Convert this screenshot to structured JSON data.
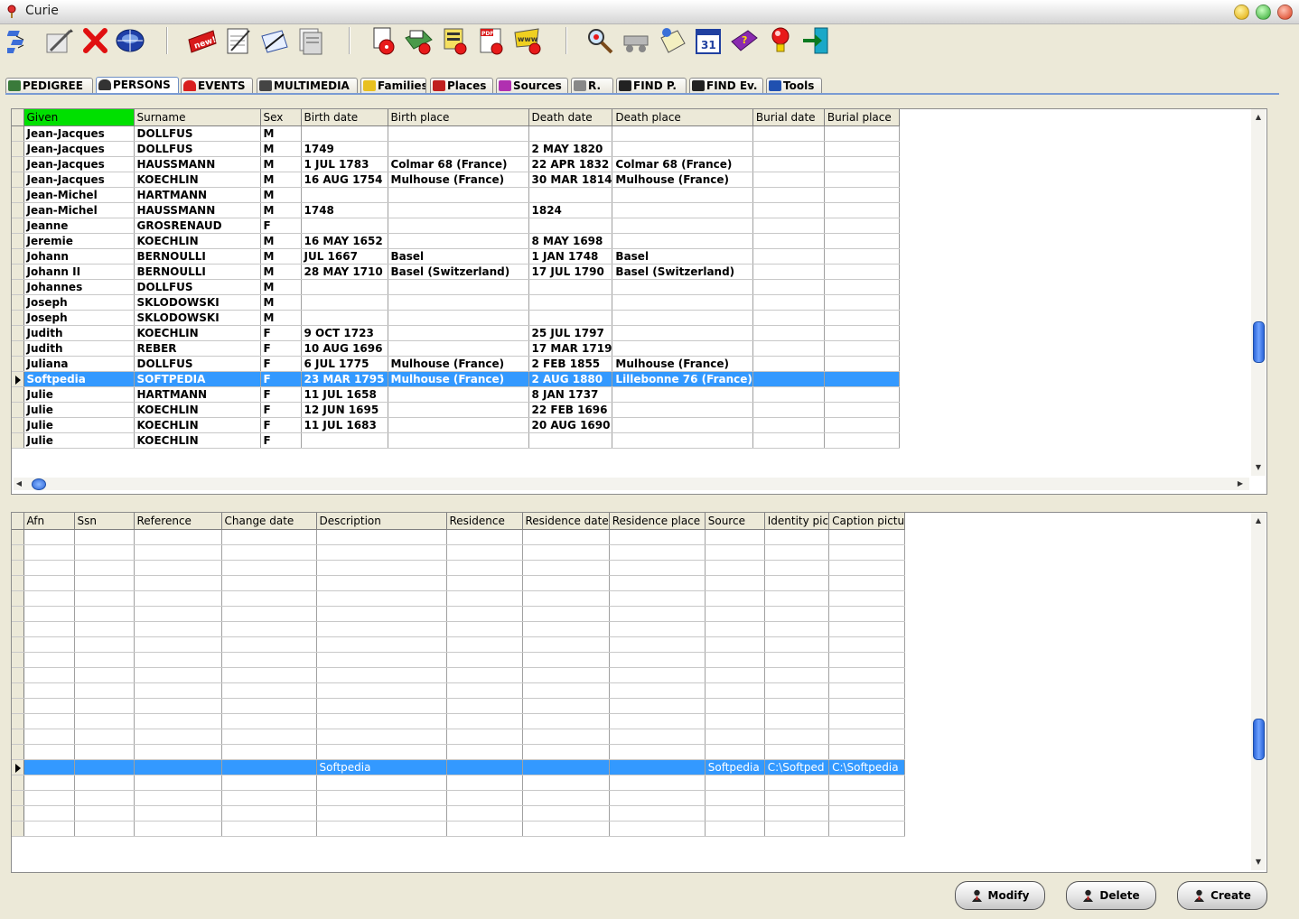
{
  "window": {
    "title": "Curie",
    "accent": "#3399ff",
    "header_highlight": "#00e000"
  },
  "toolbar": {
    "buttons": [
      {
        "name": "pedigree-tree-button",
        "icon": "tree-icon"
      },
      {
        "name": "edit-button",
        "icon": "pencil-icon"
      },
      {
        "name": "delete-button",
        "icon": "red-x-icon"
      },
      {
        "name": "compass-button",
        "icon": "compass-icon"
      },
      {
        "name": "new-button",
        "icon": "new-badge-icon"
      },
      {
        "name": "gedcom-export-button",
        "icon": "gedcom-icon"
      },
      {
        "name": "write-button",
        "icon": "quill-icon"
      },
      {
        "name": "report-button",
        "icon": "document-icon"
      },
      {
        "name": "gedcom-import-button",
        "icon": "gedcom-cd-icon"
      },
      {
        "name": "print-button",
        "icon": "printer-icon"
      },
      {
        "name": "report-cd-button",
        "icon": "report-cd-icon"
      },
      {
        "name": "pdf-button",
        "icon": "pdf-icon"
      },
      {
        "name": "web-button",
        "icon": "www-icon"
      },
      {
        "name": "search-button",
        "icon": "magnifier-icon"
      },
      {
        "name": "relationship-button",
        "icon": "cart-icon"
      },
      {
        "name": "notes-button",
        "icon": "scroll-icon"
      },
      {
        "name": "calendar-button",
        "icon": "calendar-icon"
      },
      {
        "name": "help-book-button",
        "icon": "book-icon"
      },
      {
        "name": "tips-button",
        "icon": "lightbulb-icon"
      },
      {
        "name": "exit-button",
        "icon": "exit-door-icon"
      }
    ]
  },
  "tabs": [
    {
      "label": "PEDIGREE",
      "icon": "pedigree-icon"
    },
    {
      "label": "PERSONS",
      "icon": "person-icon",
      "active": true
    },
    {
      "label": "EVENTS",
      "icon": "bell-icon"
    },
    {
      "label": "MULTIMEDIA",
      "icon": "camera-icon"
    },
    {
      "label": "Families",
      "icon": "family-icon"
    },
    {
      "label": "Places",
      "icon": "places-icon"
    },
    {
      "label": "Sources",
      "icon": "books-icon"
    },
    {
      "label": "R.",
      "icon": "edit-icon"
    },
    {
      "label": "FIND P.",
      "icon": "binoculars-icon"
    },
    {
      "label": "FIND Ev.",
      "icon": "binoculars-icon"
    },
    {
      "label": "Tools",
      "icon": "tools-icon"
    }
  ],
  "persons_grid": {
    "columns": [
      "Given",
      "Surname",
      "Sex",
      "Birth date",
      "Birth place",
      "Death date",
      "Death place",
      "Burial date",
      "Burial place"
    ],
    "rows": [
      [
        "Jean-Jacques",
        "DOLLFUS",
        "M",
        "",
        "",
        "",
        "",
        "",
        ""
      ],
      [
        "Jean-Jacques",
        "DOLLFUS",
        "M",
        "1749",
        "",
        "2 MAY 1820",
        "",
        "",
        ""
      ],
      [
        "Jean-Jacques",
        "HAUSSMANN",
        "M",
        "1 JUL 1783",
        "Colmar  68  (France)",
        "22 APR 1832",
        "Colmar  68  (France)",
        "",
        ""
      ],
      [
        "Jean-Jacques",
        "KOECHLIN",
        "M",
        "16 AUG 1754",
        "Mulhouse (France)",
        "30 MAR 1814",
        "Mulhouse (France)",
        "",
        ""
      ],
      [
        "Jean-Michel",
        "HARTMANN",
        "M",
        "",
        "",
        "",
        "",
        "",
        ""
      ],
      [
        "Jean-Michel",
        "HAUSSMANN",
        "M",
        "1748",
        "",
        "1824",
        "",
        "",
        ""
      ],
      [
        "Jeanne",
        "GROSRENAUD",
        "F",
        "",
        "",
        "",
        "",
        "",
        ""
      ],
      [
        "Jeremie",
        "KOECHLIN",
        "M",
        "16 MAY 1652",
        "",
        "8 MAY 1698",
        "",
        "",
        ""
      ],
      [
        "Johann",
        "BERNOULLI",
        "M",
        "JUL 1667",
        "Basel",
        "1 JAN 1748",
        "Basel",
        "",
        ""
      ],
      [
        "Johann II",
        "BERNOULLI",
        "M",
        "28 MAY 1710",
        "Basel (Switzerland)",
        "17 JUL 1790",
        "Basel (Switzerland)",
        "",
        ""
      ],
      [
        "Johannes",
        "DOLLFUS",
        "M",
        "",
        "",
        "",
        "",
        "",
        ""
      ],
      [
        "Joseph",
        "SKLODOWSKI",
        "M",
        "",
        "",
        "",
        "",
        "",
        ""
      ],
      [
        "Joseph",
        "SKLODOWSKI",
        "M",
        "",
        "",
        "",
        "",
        "",
        ""
      ],
      [
        "Judith",
        "KOECHLIN",
        "F",
        "9 OCT 1723",
        "",
        "25 JUL 1797",
        "",
        "",
        ""
      ],
      [
        "Judith",
        "REBER",
        "F",
        "10 AUG 1696",
        "",
        "17 MAR 1719",
        "",
        "",
        ""
      ],
      [
        "Juliana",
        "DOLLFUS",
        "F",
        "6 JUL 1775",
        "Mulhouse (France)",
        "2 FEB 1855",
        "Mulhouse (France)",
        "",
        ""
      ],
      [
        "Softpedia",
        "SOFTPEDIA",
        "F",
        "23 MAR 1795",
        "Mulhouse (France)",
        "2 AUG 1880",
        "Lillebonne 76 (France)",
        "",
        ""
      ],
      [
        "Julie",
        "HARTMANN",
        "F",
        "11 JUL 1658",
        "",
        "8 JAN 1737",
        "",
        "",
        ""
      ],
      [
        "Julie",
        "KOECHLIN",
        "F",
        "12 JUN 1695",
        "",
        "22 FEB 1696",
        "",
        "",
        ""
      ],
      [
        "Julie",
        "KOECHLIN",
        "F",
        "11 JUL 1683",
        "",
        "20 AUG 1690",
        "",
        "",
        ""
      ],
      [
        "Julie",
        "KOECHLIN",
        "F",
        "",
        "",
        "",
        "",
        "",
        ""
      ]
    ],
    "selected_row": 16
  },
  "details_grid": {
    "columns": [
      "Afn",
      "Ssn",
      "Reference",
      "Change date",
      "Description",
      "Residence",
      "Residence date",
      "Residence place",
      "Source",
      "Identity pic",
      "Caption pictu"
    ],
    "rows": [
      [
        "",
        "",
        "",
        "",
        "",
        "",
        "",
        "",
        "",
        "",
        ""
      ],
      [
        "",
        "",
        "",
        "",
        "",
        "",
        "",
        "",
        "",
        "",
        ""
      ],
      [
        "",
        "",
        "",
        "",
        "",
        "",
        "",
        "",
        "",
        "",
        ""
      ],
      [
        "",
        "",
        "",
        "",
        "",
        "",
        "",
        "",
        "",
        "",
        ""
      ],
      [
        "",
        "",
        "",
        "",
        "",
        "",
        "",
        "",
        "",
        "",
        ""
      ],
      [
        "",
        "",
        "",
        "",
        "",
        "",
        "",
        "",
        "",
        "",
        ""
      ],
      [
        "",
        "",
        "",
        "",
        "",
        "",
        "",
        "",
        "",
        "",
        ""
      ],
      [
        "",
        "",
        "",
        "",
        "",
        "",
        "",
        "",
        "",
        "",
        ""
      ],
      [
        "",
        "",
        "",
        "",
        "",
        "",
        "",
        "",
        "",
        "",
        ""
      ],
      [
        "",
        "",
        "",
        "",
        "",
        "",
        "",
        "",
        "",
        "",
        ""
      ],
      [
        "",
        "",
        "",
        "",
        "",
        "",
        "",
        "",
        "",
        "",
        ""
      ],
      [
        "",
        "",
        "",
        "",
        "",
        "",
        "",
        "",
        "",
        "",
        ""
      ],
      [
        "",
        "",
        "",
        "",
        "",
        "",
        "",
        "",
        "",
        "",
        ""
      ],
      [
        "",
        "",
        "",
        "",
        "",
        "",
        "",
        "",
        "",
        "",
        ""
      ],
      [
        "",
        "",
        "",
        "",
        "",
        "",
        "",
        "",
        "",
        "",
        ""
      ],
      [
        "",
        "",
        "",
        "",
        "Softpedia",
        "",
        "",
        "",
        "Softpedia",
        "C:\\Softped",
        "C:\\Softpedia"
      ],
      [
        "",
        "",
        "",
        "",
        "",
        "",
        "",
        "",
        "",
        "",
        ""
      ],
      [
        "",
        "",
        "",
        "",
        "",
        "",
        "",
        "",
        "",
        "",
        ""
      ],
      [
        "",
        "",
        "",
        "",
        "",
        "",
        "",
        "",
        "",
        "",
        ""
      ],
      [
        "",
        "",
        "",
        "",
        "",
        "",
        "",
        "",
        "",
        "",
        ""
      ]
    ],
    "selected_row": 15
  },
  "actions": {
    "modify_label": "Modify",
    "delete_label": "Delete",
    "create_label": "Create"
  }
}
